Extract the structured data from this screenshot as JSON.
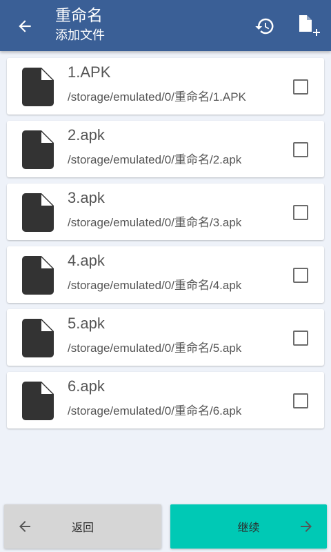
{
  "toolbar": {
    "title": "重命名",
    "subtitle": "添加文件",
    "icons": [
      "back-arrow-icon",
      "history-icon",
      "add-file-icon"
    ]
  },
  "files": [
    {
      "name": "1.APK",
      "path": "/storage/emulated/0/重命名/1.APK",
      "checked": false
    },
    {
      "name": "2.apk",
      "path": "/storage/emulated/0/重命名/2.apk",
      "checked": false
    },
    {
      "name": "3.apk",
      "path": "/storage/emulated/0/重命名/3.apk",
      "checked": false
    },
    {
      "name": "4.apk",
      "path": "/storage/emulated/0/重命名/4.apk",
      "checked": false
    },
    {
      "name": "5.apk",
      "path": "/storage/emulated/0/重命名/5.apk",
      "checked": false
    },
    {
      "name": "6.apk",
      "path": "/storage/emulated/0/重命名/6.apk",
      "checked": false
    }
  ],
  "bottom": {
    "back_label": "返回",
    "continue_label": "继续"
  },
  "colors": {
    "toolbar": "#3a5f96",
    "background": "#eef2f9",
    "continue_button": "#00c9b5",
    "back_button": "#d6d6d6",
    "file_icon": "#333333"
  }
}
